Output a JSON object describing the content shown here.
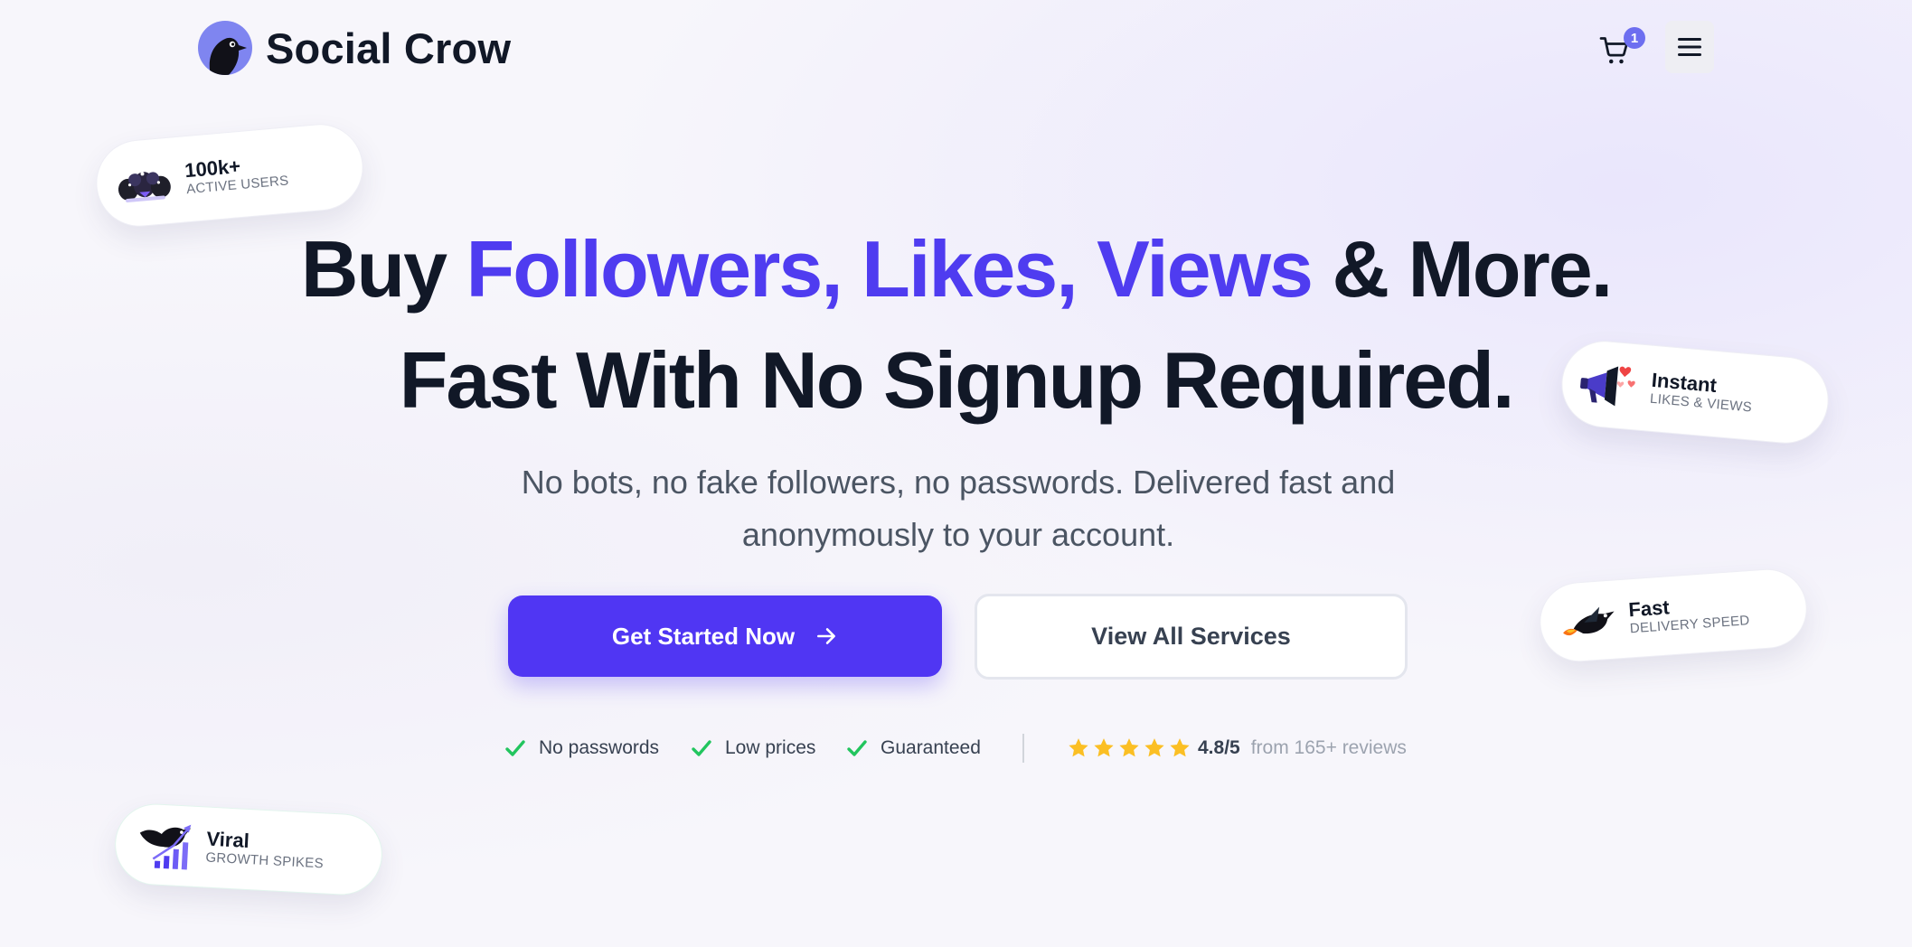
{
  "header": {
    "brand": "Social Crow",
    "cart_count": "1",
    "colors": {
      "accent": "#4f3cf0",
      "badge": "#6d6ef0",
      "logo_bg": "#7f85f0"
    }
  },
  "hero": {
    "line1": {
      "prefix": "Buy ",
      "accent": "Followers, Likes, Views",
      "suffix": " & More."
    },
    "line2": "Fast With No Signup Required.",
    "subtitle_line1": "No bots, no fake followers, no passwords. Delivered fast and",
    "subtitle_line2": "anonymously to your account."
  },
  "buttons": {
    "primary": "Get Started Now",
    "secondary": "View All Services"
  },
  "trust": {
    "items": [
      "No passwords",
      "Low prices",
      "Guaranteed"
    ],
    "stars": 5,
    "rating": "4.8/5",
    "reviews": "from 165+ reviews"
  },
  "pills": {
    "users": {
      "title": "100k+",
      "sub": "ACTIVE USERS",
      "icon": "crow-crowd-icon"
    },
    "instant": {
      "title": "Instant",
      "sub": "LIKES & VIEWS",
      "icon": "megaphone-hearts-icon"
    },
    "fast": {
      "title": "Fast",
      "sub": "DELIVERY SPEED",
      "icon": "rocket-crow-icon"
    },
    "viral": {
      "title": "Viral",
      "sub": "GROWTH SPIKES",
      "icon": "crow-growth-chart-icon"
    }
  }
}
